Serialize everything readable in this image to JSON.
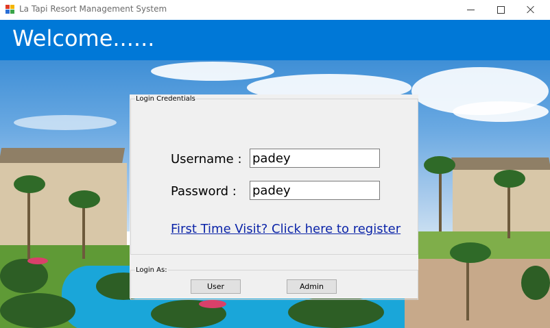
{
  "window": {
    "title": "La Tapi Resort Management System",
    "controls": {
      "minimize": "minimize",
      "maximize": "maximize",
      "close": "close"
    }
  },
  "header": {
    "title": "Welcome......",
    "color": "#0078d7"
  },
  "credentials_group": {
    "title": "Login Credentials",
    "username_label": "Username :",
    "username_value": "padey",
    "password_label": "Password :",
    "password_value": "padey",
    "register_link": "First Time Visit? Click here to register"
  },
  "login_group": {
    "title": "Login As:",
    "user_button": "User",
    "admin_button": "Admin"
  },
  "icons": {
    "app": "app-icon",
    "minimize": "minimize-icon",
    "maximize": "maximize-icon",
    "close": "close-icon"
  },
  "colors": {
    "accent": "#0078d7",
    "link": "#0b24a8",
    "panel": "#f0f0f0"
  }
}
